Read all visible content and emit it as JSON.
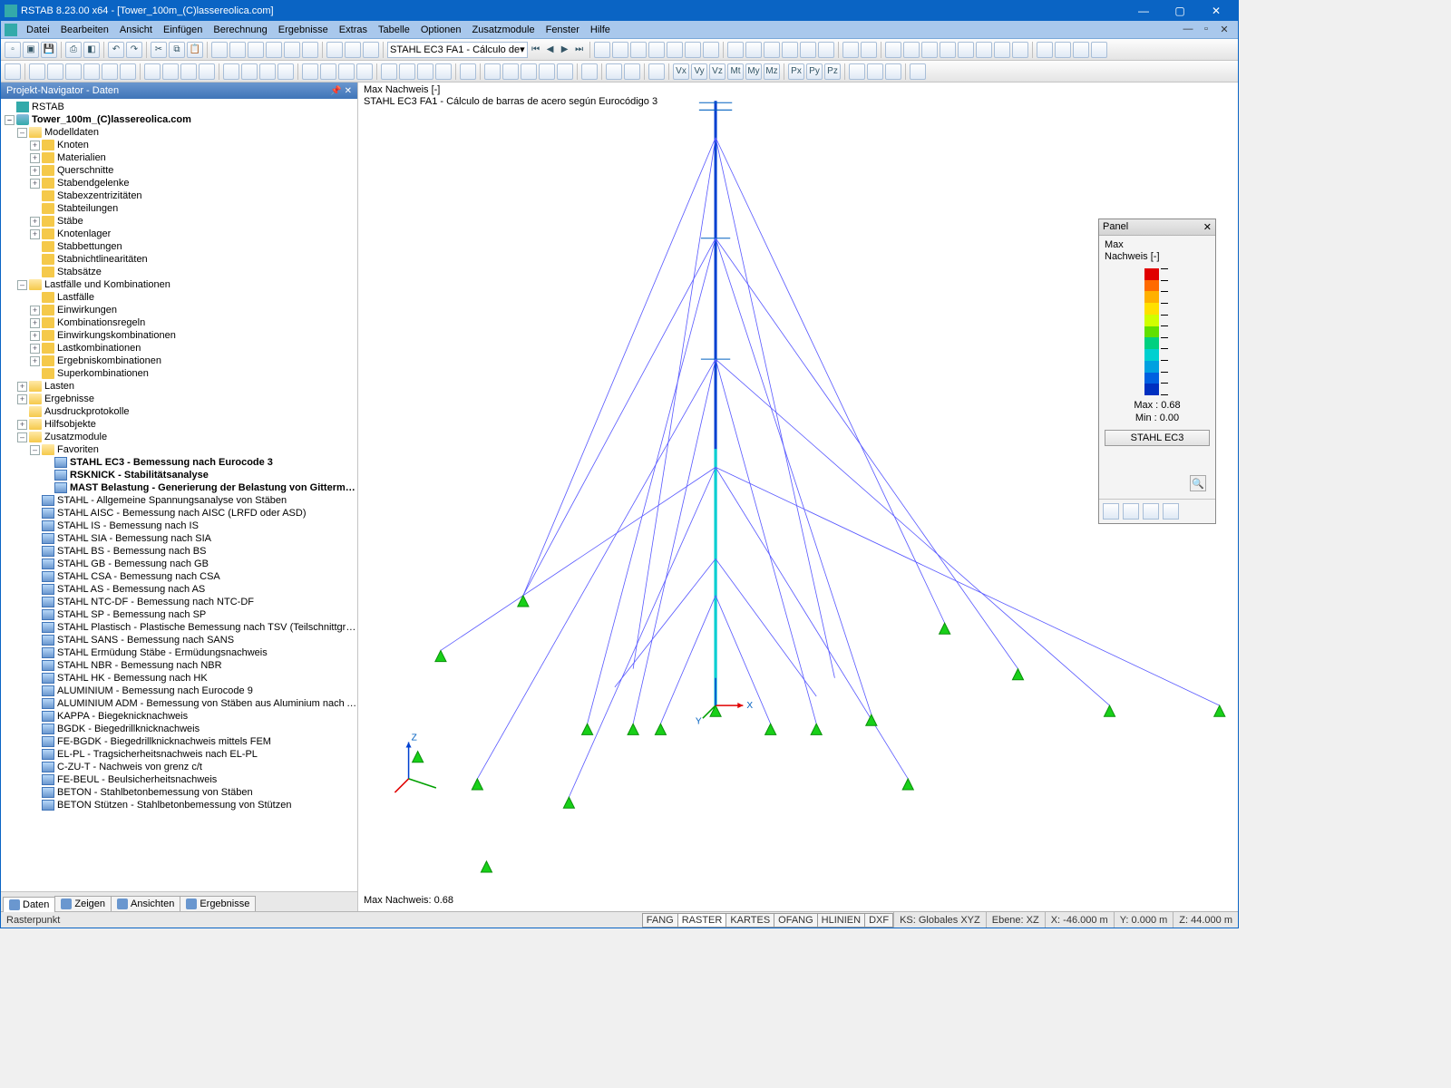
{
  "titlebar": {
    "title": "RSTAB 8.23.00 x64 - [Tower_100m_(C)lassereolica.com]"
  },
  "menu": {
    "items": [
      "Datei",
      "Bearbeiten",
      "Ansicht",
      "Einfügen",
      "Berechnung",
      "Ergebnisse",
      "Extras",
      "Tabelle",
      "Optionen",
      "Zusatzmodule",
      "Fenster",
      "Hilfe"
    ]
  },
  "toolbar1": {
    "combo": "STAHL EC3 FA1 - Cálculo de"
  },
  "navigator": {
    "title": "Projekt-Navigator - Daten",
    "root_app": "RSTAB",
    "root_project": "Tower_100m_(C)lassereolica.com",
    "modelldaten": {
      "label": "Modelldaten",
      "items": [
        "Knoten",
        "Materialien",
        "Querschnitte",
        "Stabendgelenke",
        "Stabexzentrizitäten",
        "Stabteilungen",
        "Stäbe",
        "Knotenlager",
        "Stabbettungen",
        "Stabnichtlinearitäten",
        "Stabsätze"
      ]
    },
    "lastfaelle": {
      "label": "Lastfälle und Kombinationen",
      "items": [
        "Lastfälle",
        "Einwirkungen",
        "Kombinationsregeln",
        "Einwirkungskombinationen",
        "Lastkombinationen",
        "Ergebniskombinationen",
        "Superkombinationen"
      ]
    },
    "lasten": "Lasten",
    "ergebnisse": "Ergebnisse",
    "ausdruck": "Ausdruckprotokolle",
    "hilfs": "Hilfsobjekte",
    "zusatz": {
      "label": "Zusatzmodule",
      "fav_label": "Favoriten",
      "fav": [
        "STAHL EC3 - Bemessung nach Eurocode 3",
        "RSKNICK - Stabilitätsanalyse",
        "MAST Belastung - Generierung der Belastung von Gittermasten"
      ],
      "mods": [
        "STAHL - Allgemeine Spannungsanalyse von Stäben",
        "STAHL AISC - Bemessung nach AISC (LRFD oder ASD)",
        "STAHL IS - Bemessung nach IS",
        "STAHL SIA - Bemessung nach SIA",
        "STAHL BS - Bemessung nach BS",
        "STAHL GB - Bemessung nach GB",
        "STAHL CSA - Bemessung nach CSA",
        "STAHL AS - Bemessung nach AS",
        "STAHL NTC-DF - Bemessung nach NTC-DF",
        "STAHL SP - Bemessung nach SP",
        "STAHL Plastisch - Plastische Bemessung nach TSV (Teilschnittgrößenverfa",
        "STAHL SANS - Bemessung nach SANS",
        "STAHL Ermüdung Stäbe - Ermüdungsnachweis",
        "STAHL NBR - Bemessung nach NBR",
        "STAHL HK - Bemessung nach HK",
        "ALUMINIUM - Bemessung nach Eurocode 9",
        "ALUMINIUM ADM - Bemessung von Stäben aus Aluminium nach ADM",
        "KAPPA - Biegeknicknachweis",
        "BGDK - Biegedrillknicknachweis",
        "FE-BGDK - Biegedrillknicknachweis mittels FEM",
        "EL-PL - Tragsicherheitsnachweis nach EL-PL",
        "C-ZU-T - Nachweis von grenz c/t",
        "FE-BEUL - Beulsicherheitsnachweis",
        "BETON - Stahlbetonbemessung von Stäben",
        "BETON Stützen - Stahlbetonbemessung von Stützen"
      ]
    },
    "tabs": [
      "Daten",
      "Zeigen",
      "Ansichten",
      "Ergebnisse"
    ]
  },
  "viewport": {
    "line1": "Max Nachweis [-]",
    "line2": "STAHL EC3 FA1 - Cálculo de barras de acero según Eurocódigo 3",
    "footer": "Max Nachweis: 0.68",
    "axes": {
      "x": "X",
      "y": "Y",
      "z": "Z"
    }
  },
  "panel": {
    "title": "Panel",
    "l1": "Max",
    "l2": "Nachweis [-]",
    "max": "Max  :  0.68",
    "min": "Min   :  0.00",
    "button": "STAHL EC3"
  },
  "status": {
    "left": "Rasterpunkt",
    "tabs": [
      "FANG",
      "RASTER",
      "KARTES",
      "OFANG",
      "HLINIEN",
      "DXF"
    ],
    "ks": "KS: Globales XYZ",
    "ebene": "Ebene: XZ",
    "x": "X: -46.000 m",
    "y": "Y: 0.000 m",
    "z": "Z: 44.000 m"
  }
}
